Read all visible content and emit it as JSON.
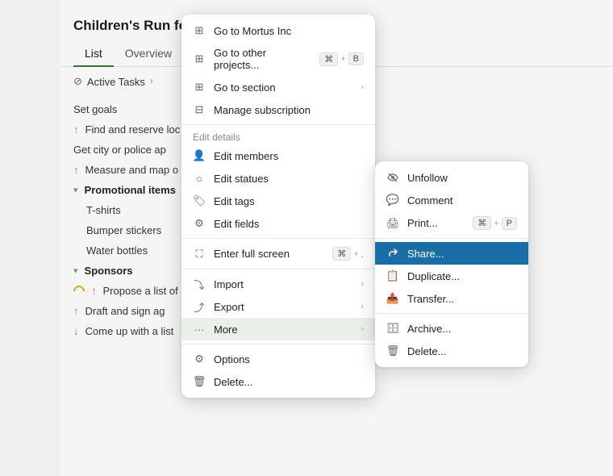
{
  "header": {
    "project_title": "Children's Run for Charity",
    "chevron": "▾"
  },
  "tabs": [
    {
      "label": "List",
      "active": true
    },
    {
      "label": "Overview",
      "active": false
    }
  ],
  "tab_add_label": "+",
  "filter": {
    "label": "Active Tasks",
    "chevron": "›"
  },
  "tasks": [
    {
      "indent": 0,
      "text": "Set goals",
      "arrow": ""
    },
    {
      "indent": 0,
      "text": "Find and reserve loc",
      "arrow": "up",
      "arrow_type": "up"
    },
    {
      "indent": 0,
      "text": "Get city or police ap",
      "arrow": ""
    },
    {
      "indent": 0,
      "text": "Measure and map o",
      "arrow": "up",
      "arrow_type": "up"
    },
    {
      "indent": 0,
      "text": "Promotional items",
      "bold": true,
      "collapse": "▾"
    },
    {
      "indent": 1,
      "text": "T-shirts",
      "arrow": ""
    },
    {
      "indent": 1,
      "text": "Bumper stickers",
      "arrow": ""
    },
    {
      "indent": 1,
      "text": "Water bottles",
      "arrow": ""
    },
    {
      "indent": 0,
      "text": "Sponsors",
      "bold": true,
      "collapse": "▾"
    },
    {
      "indent": 0,
      "text": "Propose a list of",
      "arrow": "up",
      "arrow_type": "up",
      "half": true
    },
    {
      "indent": 0,
      "text": "Draft and sign ag",
      "arrow": "up",
      "arrow_type": "up"
    },
    {
      "indent": 0,
      "text": "Come up with a list",
      "arrow": "down",
      "arrow_type": "down"
    }
  ],
  "primary_menu": {
    "items": [
      {
        "id": "goto-mortus",
        "icon": "⊞",
        "label": "Go to Mortus Inc",
        "shortcut": ""
      },
      {
        "id": "goto-projects",
        "icon": "⊞",
        "label": "Go to other projects...",
        "shortcut": "⌘+B"
      },
      {
        "id": "goto-section",
        "icon": "⊞",
        "label": "Go to section",
        "arrow": "›"
      },
      {
        "id": "manage-sub",
        "icon": "⊟",
        "label": "Manage subscription",
        "shortcut": ""
      },
      {
        "separator": true
      },
      {
        "id": "edit-details",
        "section_label": "Edit details"
      },
      {
        "id": "edit-members",
        "icon": "👤",
        "label": "Edit members"
      },
      {
        "id": "edit-statues",
        "icon": "○",
        "label": "Edit statues"
      },
      {
        "id": "edit-tags",
        "icon": "🏷",
        "label": "Edit tags"
      },
      {
        "id": "edit-fields",
        "icon": "⚙",
        "label": "Edit fields"
      },
      {
        "separator": true
      },
      {
        "id": "fullscreen",
        "icon": "⛶",
        "label": "Enter full screen",
        "shortcut": "⌘+."
      },
      {
        "separator": true
      },
      {
        "id": "import",
        "icon": "⤵",
        "label": "Import",
        "arrow": "›"
      },
      {
        "id": "export",
        "icon": "⤴",
        "label": "Export",
        "arrow": "›"
      },
      {
        "id": "more",
        "icon": "···",
        "label": "More",
        "arrow": "›",
        "highlighted": true
      },
      {
        "separator": true
      },
      {
        "id": "options",
        "icon": "⚙",
        "label": "Options"
      },
      {
        "id": "delete",
        "icon": "🗑",
        "label": "Delete..."
      }
    ]
  },
  "secondary_menu": {
    "items": [
      {
        "id": "unfollow",
        "icon": "👁",
        "label": "Unfollow"
      },
      {
        "id": "comment",
        "icon": "💬",
        "label": "Comment"
      },
      {
        "id": "print",
        "icon": "🖨",
        "label": "Print...",
        "shortcut": "⌘+P"
      },
      {
        "separator": true
      },
      {
        "id": "share",
        "icon": "🔗",
        "label": "Share...",
        "highlighted": true
      },
      {
        "id": "duplicate",
        "icon": "📋",
        "label": "Duplicate..."
      },
      {
        "id": "transfer",
        "icon": "📤",
        "label": "Transfer..."
      },
      {
        "separator": true
      },
      {
        "id": "archive",
        "icon": "🗄",
        "label": "Archive..."
      },
      {
        "id": "delete2",
        "icon": "🗑",
        "label": "Delete..."
      }
    ]
  }
}
